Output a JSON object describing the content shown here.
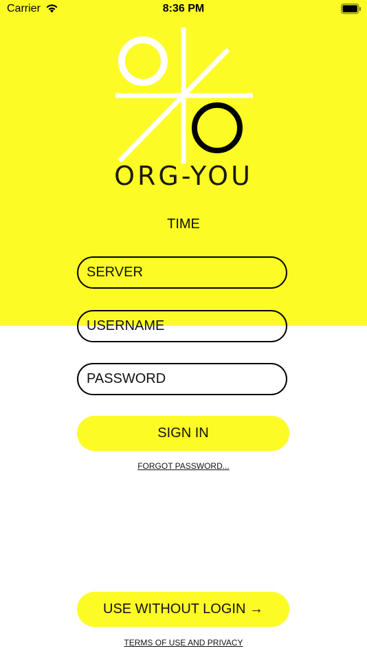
{
  "status_bar": {
    "carrier": "Carrier",
    "time": "8:36 PM",
    "wifi_icon": "wifi-icon",
    "battery_icon": "battery-icon"
  },
  "brand": {
    "name": "ORG-YOU",
    "subtitle": "TIME",
    "logo_icon": "tic-tac-toe-logo-icon"
  },
  "form": {
    "server_placeholder": "SERVER",
    "username_placeholder": "USERNAME",
    "password_placeholder": "PASSWORD",
    "sign_in_label": "SIGN IN",
    "forgot_password_label": "FORGOT PASSWORD..."
  },
  "footer": {
    "use_without_login_label": "USE WITHOUT LOGIN →",
    "terms_label": "TERMS OF USE AND PRIVACY"
  },
  "colors": {
    "accent": "#fdfb25",
    "text": "#111111",
    "background": "#ffffff"
  }
}
